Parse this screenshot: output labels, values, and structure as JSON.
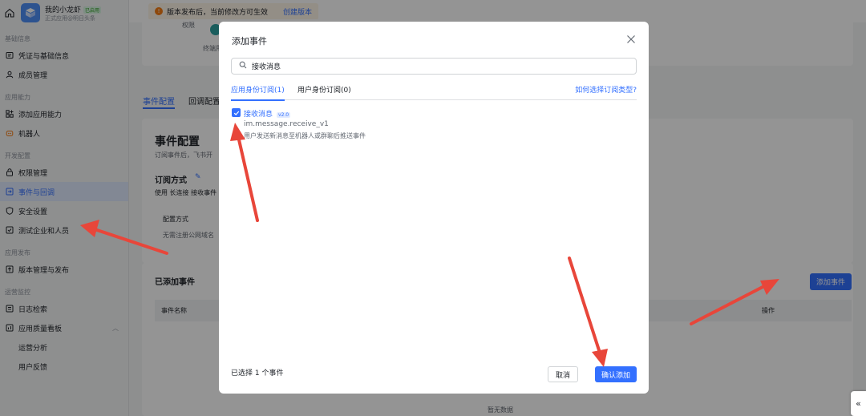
{
  "app": {
    "name": "我的小龙虾",
    "tag": "已启用",
    "subtitle": "正式应用@明日头条"
  },
  "banner": {
    "text": "版本发布后，当前修改方可生效",
    "link": "创建版本"
  },
  "sidebar": {
    "sections": [
      {
        "label": "基础信息",
        "items": [
          "凭证与基础信息",
          "成员管理"
        ]
      },
      {
        "label": "应用能力",
        "items": [
          "添加应用能力",
          "机器人"
        ]
      },
      {
        "label": "开发配置",
        "items": [
          "权限管理",
          "事件与回调",
          "安全设置",
          "测试企业和人员"
        ]
      },
      {
        "label": "应用发布",
        "items": [
          "版本管理与发布"
        ]
      },
      {
        "label": "运营监控",
        "items": [
          "日志检索",
          "应用质量看板"
        ]
      }
    ],
    "sub_items": [
      "运营分析",
      "用户反馈"
    ]
  },
  "main": {
    "top_label_1": "权限",
    "top_label_2": "终端用户",
    "tabs": [
      "事件配置",
      "回调配置"
    ],
    "title": "事件配置",
    "desc": "订阅事件后，飞书开",
    "sub_title": "订阅方式",
    "sub_desc": "使用 长连接 接收事件",
    "config_label": "配置方式",
    "config_desc": "无需注册公网域名",
    "added_title": "已添加事件",
    "add_button": "添加事件",
    "col_name": "事件名称",
    "col_action": "操作",
    "empty": "暂无数据"
  },
  "modal": {
    "title": "添加事件",
    "search_value": "接收消息",
    "tab_app": "应用身份订阅(1)",
    "tab_user": "用户身份订阅(0)",
    "help_link": "如何选择订阅类型?",
    "event": {
      "name": "接收消息",
      "version": "v2.0",
      "id": "im.message.receive_v1",
      "desc": "用户发送新消息至机器人或群聊后推送事件"
    },
    "selected_count": "已选择 1 个事件",
    "cancel": "取消",
    "confirm": "确认添加"
  },
  "colors": {
    "accent": "#3370ff",
    "arrow": "#e8463a",
    "warn": "#f57c14"
  }
}
